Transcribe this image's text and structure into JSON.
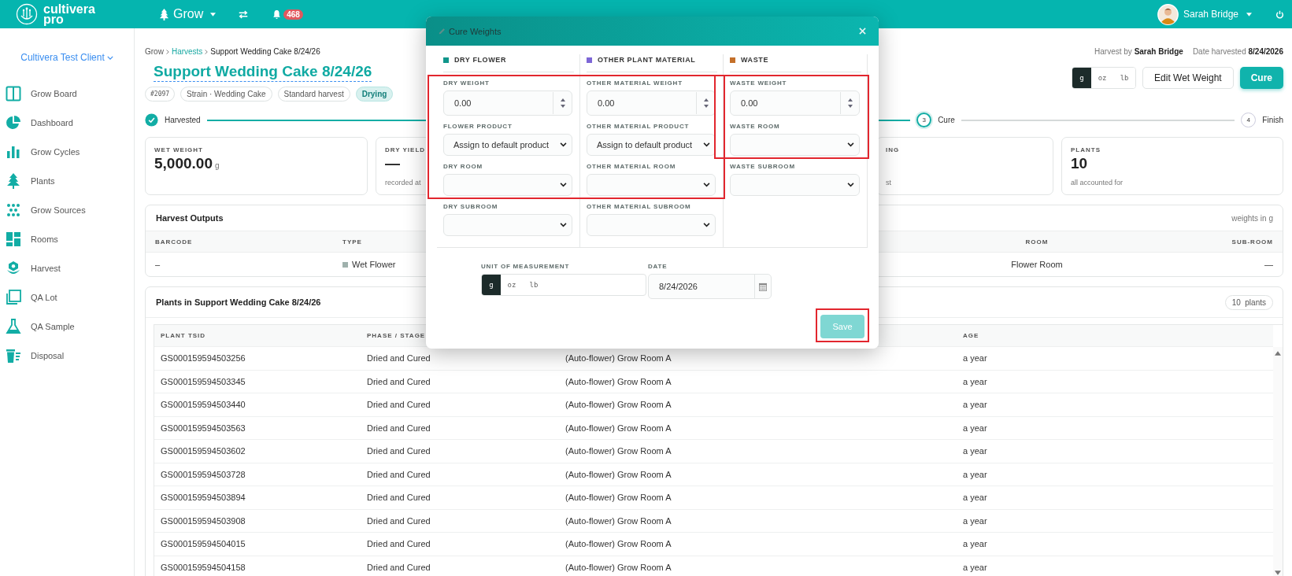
{
  "topbar": {
    "logo": [
      "cultivera",
      "pro"
    ],
    "module": "Grow",
    "notifications": "468",
    "user": "Sarah Bridge"
  },
  "sidebar": {
    "client": "Cultivera Test Client",
    "items": [
      {
        "label": "Grow Board",
        "kind": "board"
      },
      {
        "label": "Dashboard",
        "kind": "pie"
      },
      {
        "label": "Grow Cycles",
        "kind": "bars"
      },
      {
        "label": "Plants",
        "kind": "tree"
      },
      {
        "label": "Grow Sources",
        "kind": "dots"
      },
      {
        "label": "Rooms",
        "kind": "tiles"
      },
      {
        "label": "Harvest",
        "kind": "flower"
      },
      {
        "label": "QA Lot",
        "kind": "squares"
      },
      {
        "label": "QA Sample",
        "kind": "flask"
      },
      {
        "label": "Disposal",
        "kind": "trash"
      }
    ]
  },
  "breadcrumb": [
    {
      "label": "Grow",
      "kind": "plain"
    },
    {
      "label": "Harvests",
      "kind": "link"
    },
    {
      "label": "Support Wedding Cake 8/24/26",
      "kind": "current"
    }
  ],
  "title": "Support Wedding Cake 8/24/26",
  "tags": [
    {
      "label": "#2097",
      "kind": "id"
    },
    {
      "label": "Strain · Wedding Cake",
      "kind": "plain"
    },
    {
      "label": "Standard harvest",
      "kind": "plain"
    },
    {
      "label": "Drying",
      "kind": "status"
    }
  ],
  "meta": {
    "harvest_by_label": "Harvest by",
    "harvest_by": "Sarah Bridge",
    "date_label": "Date harvested",
    "date": "8/24/2026"
  },
  "units": [
    {
      "label": "g",
      "selected": true
    },
    {
      "label": "oz",
      "selected": false
    },
    {
      "label": "lb",
      "selected": false
    }
  ],
  "actions": [
    {
      "label": "Edit Wet Weight",
      "kind": "secondary"
    },
    {
      "label": "Cure",
      "kind": "primary"
    }
  ],
  "steps": [
    {
      "label": "Harvested",
      "kind": "done"
    },
    {
      "number": "3",
      "label": "Cure",
      "kind": "current"
    },
    {
      "number": "4",
      "label": "Finish",
      "kind": "upcoming"
    }
  ],
  "stats": [
    {
      "label": "WET WEIGHT",
      "value": "5,000.00",
      "unit": "g"
    },
    {
      "label": "DRY YIELD",
      "value": "—",
      "note": "recorded at"
    },
    {
      "label": "ING",
      "note": "st"
    },
    {
      "label": "PLANTS",
      "value": "10",
      "note": "all accounted for"
    }
  ],
  "outputs": {
    "title": "Harvest Outputs",
    "note": "weights in g",
    "columns": [
      "BARCODE",
      "TYPE",
      "ROOM",
      "SUB-ROOM"
    ],
    "rows": [
      {
        "barcode": "–",
        "type": "Wet Flower",
        "color": "#9fb1ad",
        "room": "Flower Room",
        "sub_room": "—"
      }
    ]
  },
  "plants": {
    "title": "Plants in Support Wedding Cake 8/24/26",
    "count": "10",
    "count_unit": "plants",
    "columns": [
      "PLANT TSID",
      "PHASE / STAGE",
      "AGE"
    ],
    "rows": [
      {
        "tsid": "GS000159594503256",
        "phase": "Dried and Cured",
        "column_3": "(Auto-flower) Grow Room A",
        "age": "a year"
      },
      {
        "tsid": "GS000159594503345",
        "phase": "Dried and Cured",
        "column_3": "(Auto-flower) Grow Room A",
        "age": "a year"
      },
      {
        "tsid": "GS000159594503440",
        "phase": "Dried and Cured",
        "column_3": "(Auto-flower) Grow Room A",
        "age": "a year"
      },
      {
        "tsid": "GS000159594503563",
        "phase": "Dried and Cured",
        "column_3": "(Auto-flower) Grow Room A",
        "age": "a year"
      },
      {
        "tsid": "GS000159594503602",
        "phase": "Dried and Cured",
        "column_3": "(Auto-flower) Grow Room A",
        "age": "a year"
      },
      {
        "tsid": "GS000159594503728",
        "phase": "Dried and Cured",
        "column_3": "(Auto-flower) Grow Room A",
        "age": "a year"
      },
      {
        "tsid": "GS000159594503894",
        "phase": "Dried and Cured",
        "column_3": "(Auto-flower) Grow Room A",
        "age": "a year"
      },
      {
        "tsid": "GS000159594503908",
        "phase": "Dried and Cured",
        "column_3": "(Auto-flower) Grow Room A",
        "age": "a year"
      },
      {
        "tsid": "GS000159594504015",
        "phase": "Dried and Cured",
        "column_3": "(Auto-flower) Grow Room A",
        "age": "a year"
      },
      {
        "tsid": "GS000159594504158",
        "phase": "Dried and Cured",
        "column_3": "(Auto-flower) Grow Room A",
        "age": "a year"
      }
    ]
  },
  "modal": {
    "title": "Cure Weights",
    "sections": [
      {
        "title": "DRY FLOWER",
        "color": "#10968b",
        "fields": [
          {
            "label": "DRY WEIGHT",
            "kind": "number",
            "value": "0.00",
            "highlighted": true
          },
          {
            "label": "FLOWER PRODUCT",
            "kind": "select",
            "value": "Assign to default product",
            "highlighted": true
          },
          {
            "label": "DRY ROOM",
            "kind": "select",
            "highlighted": true
          },
          {
            "label": "DRY SUBROOM",
            "kind": "select",
            "highlighted": false
          }
        ]
      },
      {
        "title": "OTHER PLANT MATERIAL",
        "color": "#7d66d6",
        "fields": [
          {
            "label": "OTHER MATERIAL WEIGHT",
            "kind": "number",
            "value": "0.00",
            "highlighted": true
          },
          {
            "label": "OTHER MATERIAL PRODUCT",
            "kind": "select",
            "value": "Assign to default product",
            "highlighted": true
          },
          {
            "label": "OTHER MATERIAL ROOM",
            "kind": "select",
            "highlighted": true
          },
          {
            "label": "OTHER MATERIAL SUBROOM",
            "kind": "select",
            "highlighted": false
          }
        ]
      },
      {
        "title": "WASTE",
        "color": "#c4702a",
        "fields": [
          {
            "label": "WASTE WEIGHT",
            "kind": "number",
            "value": "0.00",
            "highlighted": true
          },
          {
            "label": "WASTE ROOM",
            "kind": "select",
            "highlighted": true
          },
          {
            "label": "WASTE SUBROOM",
            "kind": "select",
            "highlighted": false
          }
        ]
      }
    ],
    "unit_label": "UNIT OF MEASUREMENT",
    "units": [
      {
        "label": "g",
        "selected": true
      },
      {
        "label": "oz",
        "selected": false
      },
      {
        "label": "lb",
        "selected": false
      }
    ],
    "date_label": "DATE",
    "date": "8/24/2026",
    "save": {
      "label": "Save",
      "disabled": true,
      "highlighted": true
    }
  }
}
